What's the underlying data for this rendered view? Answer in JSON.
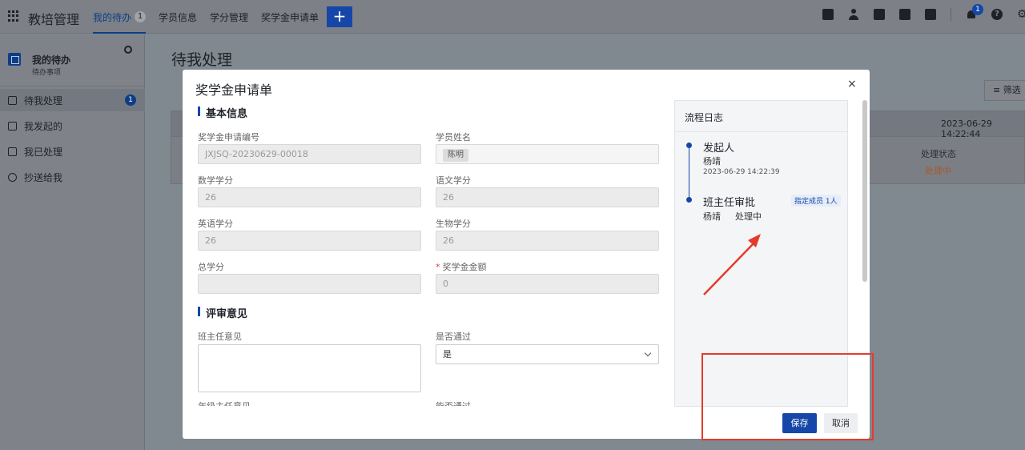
{
  "topbar": {
    "app_title": "教培管理",
    "nav": [
      {
        "label": "我的待办",
        "count": "1",
        "active": true
      },
      {
        "label": "学员信息"
      },
      {
        "label": "学分管理"
      },
      {
        "label": "奖学金申请单"
      }
    ],
    "add_label": "+",
    "notification_count": "1",
    "help_glyph": "?",
    "icons": [
      "calendar-check-icon",
      "contacts-icon",
      "document-icon",
      "phone-book-icon",
      "calendar-icon",
      "bell-icon",
      "help-icon",
      "settings-icon"
    ]
  },
  "sidebar": {
    "title": "我的待办",
    "subtitle": "待办事项",
    "items": [
      {
        "label": "待我处理",
        "badge": "1",
        "active": true
      },
      {
        "label": "我发起的"
      },
      {
        "label": "我已处理"
      },
      {
        "label": "抄送给我"
      }
    ]
  },
  "main": {
    "title": "待我处理",
    "filter_label": "筛选",
    "row_timestamp": "2023-06-29 14:22:44",
    "status_label": "处理状态",
    "status_value": "处理中"
  },
  "modal": {
    "title": "奖学金申请单",
    "close_glyph": "×",
    "section_basic": "基本信息",
    "fields": {
      "app_no_label": "奖学金申请编号",
      "app_no_value": "JXJSQ-20230629-00018",
      "student_name_label": "学员姓名",
      "student_name_value": "陈明",
      "math_label": "数学学分",
      "math_value": "26",
      "chinese_label": "语文学分",
      "chinese_value": "26",
      "english_label": "英语学分",
      "english_value": "26",
      "biology_label": "生物学分",
      "biology_value": "26",
      "total_label": "总学分",
      "total_value": "",
      "amount_label": "奖学金金额",
      "amount_value": "0"
    },
    "section_review": "评审意见",
    "review": {
      "teacher_opinion_label": "班主任意见",
      "pass_label": "是否通过",
      "pass_value": "是",
      "grade_opinion_label": "年级主任意见",
      "grade_pass_label": "能否通过"
    },
    "flow": {
      "title": "流程日志",
      "steps": [
        {
          "node": "发起人",
          "person": "杨靖",
          "time": "2023-06-29 14:22:39"
        },
        {
          "node": "班主任审批",
          "person": "杨靖",
          "status": "处理中",
          "tag": "指定成员 1人"
        }
      ]
    },
    "save_label": "保存",
    "cancel_label": "取消"
  },
  "colors": {
    "accent": "#1647a8",
    "annotation": "#e53b2c",
    "status_processing": "#a4592a"
  }
}
